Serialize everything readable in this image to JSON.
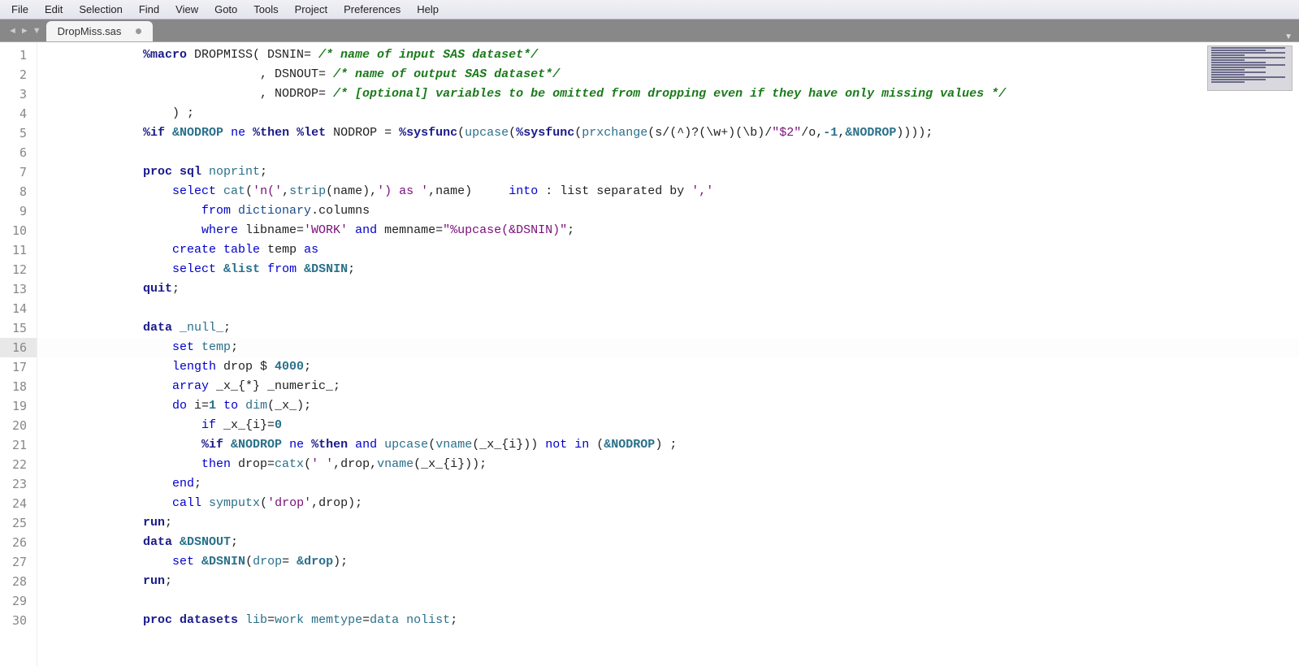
{
  "menu": [
    "File",
    "Edit",
    "Selection",
    "Find",
    "View",
    "Goto",
    "Tools",
    "Project",
    "Preferences",
    "Help"
  ],
  "tab": {
    "name": "DropMiss.sas"
  },
  "current_line": 16,
  "lines": [
    {
      "n": 1,
      "tokens": [
        [
          "kw",
          "%macro"
        ],
        [
          "id",
          " DROPMISS( DSNIN= "
        ],
        [
          "cm",
          "/* name of input SAS dataset*/"
        ]
      ]
    },
    {
      "n": 2,
      "tokens": [
        [
          "id",
          "                , DSNOUT= "
        ],
        [
          "cm",
          "/* name of output SAS dataset*/"
        ]
      ]
    },
    {
      "n": 3,
      "tokens": [
        [
          "id",
          "                , NODROP= "
        ],
        [
          "cm",
          "/* [optional] variables to be omitted from dropping even if they have only missing values */"
        ]
      ]
    },
    {
      "n": 4,
      "tokens": [
        [
          "id",
          "    ) ;"
        ]
      ]
    },
    {
      "n": 5,
      "tokens": [
        [
          "kw",
          "%if"
        ],
        [
          "id",
          " "
        ],
        [
          "mv",
          "&NODROP"
        ],
        [
          "id",
          " "
        ],
        [
          "kw2",
          "ne"
        ],
        [
          "id",
          " "
        ],
        [
          "kw",
          "%then %let"
        ],
        [
          "id",
          " NODROP = "
        ],
        [
          "kw",
          "%sysfunc"
        ],
        [
          "id",
          "("
        ],
        [
          "fn",
          "upcase"
        ],
        [
          "id",
          "("
        ],
        [
          "kw",
          "%sysfunc"
        ],
        [
          "id",
          "("
        ],
        [
          "fn",
          "prxchange"
        ],
        [
          "id",
          "(s/(^)?(\\w+)(\\b)/"
        ],
        [
          "st",
          "\"$2\""
        ],
        [
          "id",
          "/o,"
        ],
        [
          "num",
          "-1"
        ],
        [
          "id",
          ","
        ],
        [
          "mv",
          "&NODROP"
        ],
        [
          "id",
          "))));"
        ]
      ]
    },
    {
      "n": 6,
      "tokens": [
        [
          "id",
          ""
        ]
      ]
    },
    {
      "n": 7,
      "tokens": [
        [
          "kw",
          "proc sql"
        ],
        [
          "id",
          " "
        ],
        [
          "fn",
          "noprint"
        ],
        [
          "id",
          ";"
        ]
      ]
    },
    {
      "n": 8,
      "tokens": [
        [
          "id",
          "    "
        ],
        [
          "kw2",
          "select"
        ],
        [
          "id",
          " "
        ],
        [
          "fn",
          "cat"
        ],
        [
          "id",
          "("
        ],
        [
          "st",
          "'n('"
        ],
        [
          "id",
          ","
        ],
        [
          "fn",
          "strip"
        ],
        [
          "id",
          "(name),"
        ],
        [
          "st",
          "') as '"
        ],
        [
          "id",
          ",name)     "
        ],
        [
          "kw2",
          "into"
        ],
        [
          "id",
          " : list separated by "
        ],
        [
          "st",
          "','"
        ]
      ]
    },
    {
      "n": 9,
      "tokens": [
        [
          "id",
          "        "
        ],
        [
          "kw2",
          "from"
        ],
        [
          "id",
          " "
        ],
        [
          "fnname",
          "dictionary"
        ],
        [
          "id",
          ".columns"
        ]
      ]
    },
    {
      "n": 10,
      "tokens": [
        [
          "id",
          "        "
        ],
        [
          "kw2",
          "where"
        ],
        [
          "id",
          " libname="
        ],
        [
          "st",
          "'WORK'"
        ],
        [
          "id",
          " "
        ],
        [
          "kw2",
          "and"
        ],
        [
          "id",
          " memname="
        ],
        [
          "st",
          "\"%upcase(&DSNIN)\""
        ],
        [
          "id",
          ";"
        ]
      ]
    },
    {
      "n": 11,
      "tokens": [
        [
          "id",
          "    "
        ],
        [
          "kw2",
          "create"
        ],
        [
          "id",
          " "
        ],
        [
          "kw2",
          "table"
        ],
        [
          "id",
          " temp "
        ],
        [
          "kw2",
          "as"
        ]
      ]
    },
    {
      "n": 12,
      "tokens": [
        [
          "id",
          "    "
        ],
        [
          "kw2",
          "select"
        ],
        [
          "id",
          " "
        ],
        [
          "mv",
          "&list"
        ],
        [
          "id",
          " "
        ],
        [
          "kw2",
          "from"
        ],
        [
          "id",
          " "
        ],
        [
          "mv",
          "&DSNIN"
        ],
        [
          "id",
          ";"
        ]
      ]
    },
    {
      "n": 13,
      "tokens": [
        [
          "kw",
          "quit"
        ],
        [
          "id",
          ";"
        ]
      ]
    },
    {
      "n": 14,
      "tokens": [
        [
          "id",
          ""
        ]
      ]
    },
    {
      "n": 15,
      "tokens": [
        [
          "kw",
          "data"
        ],
        [
          "id",
          " "
        ],
        [
          "fn",
          "_null_"
        ],
        [
          "id",
          ";"
        ]
      ]
    },
    {
      "n": 16,
      "tokens": [
        [
          "id",
          "    "
        ],
        [
          "kw2",
          "set"
        ],
        [
          "id",
          " "
        ],
        [
          "fn",
          "temp"
        ],
        [
          "id",
          ";"
        ]
      ]
    },
    {
      "n": 17,
      "tokens": [
        [
          "id",
          "    "
        ],
        [
          "kw2",
          "length"
        ],
        [
          "id",
          " drop $ "
        ],
        [
          "num",
          "4000"
        ],
        [
          "id",
          ";"
        ]
      ]
    },
    {
      "n": 18,
      "tokens": [
        [
          "id",
          "    "
        ],
        [
          "kw2",
          "array"
        ],
        [
          "id",
          " _x_{*} _numeric_;"
        ]
      ]
    },
    {
      "n": 19,
      "tokens": [
        [
          "id",
          "    "
        ],
        [
          "kw2",
          "do"
        ],
        [
          "id",
          " i="
        ],
        [
          "num",
          "1"
        ],
        [
          "id",
          " "
        ],
        [
          "kw2",
          "to"
        ],
        [
          "id",
          " "
        ],
        [
          "fn",
          "dim"
        ],
        [
          "id",
          "(_x_);"
        ]
      ]
    },
    {
      "n": 20,
      "tokens": [
        [
          "id",
          "        "
        ],
        [
          "kw2",
          "if"
        ],
        [
          "id",
          " _x_{i}="
        ],
        [
          "num",
          "0"
        ]
      ]
    },
    {
      "n": 21,
      "tokens": [
        [
          "id",
          "        "
        ],
        [
          "kw",
          "%if"
        ],
        [
          "id",
          " "
        ],
        [
          "mv",
          "&NODROP"
        ],
        [
          "id",
          " "
        ],
        [
          "kw2",
          "ne"
        ],
        [
          "id",
          " "
        ],
        [
          "kw",
          "%then"
        ],
        [
          "id",
          " "
        ],
        [
          "kw2",
          "and"
        ],
        [
          "id",
          " "
        ],
        [
          "fn",
          "upcase"
        ],
        [
          "id",
          "("
        ],
        [
          "fn",
          "vname"
        ],
        [
          "id",
          "(_x_{i})) "
        ],
        [
          "kw2",
          "not"
        ],
        [
          "id",
          " "
        ],
        [
          "kw2",
          "in"
        ],
        [
          "id",
          " ("
        ],
        [
          "mv",
          "&NODROP"
        ],
        [
          "id",
          ") ;"
        ]
      ]
    },
    {
      "n": 22,
      "tokens": [
        [
          "id",
          "        "
        ],
        [
          "kw2",
          "then"
        ],
        [
          "id",
          " drop="
        ],
        [
          "fn",
          "catx"
        ],
        [
          "id",
          "("
        ],
        [
          "st",
          "' '"
        ],
        [
          "id",
          ",drop,"
        ],
        [
          "fn",
          "vname"
        ],
        [
          "id",
          "(_x_{i}));"
        ]
      ]
    },
    {
      "n": 23,
      "tokens": [
        [
          "id",
          "    "
        ],
        [
          "kw2",
          "end"
        ],
        [
          "id",
          ";"
        ]
      ]
    },
    {
      "n": 24,
      "tokens": [
        [
          "id",
          "    "
        ],
        [
          "kw2",
          "call"
        ],
        [
          "id",
          " "
        ],
        [
          "fn",
          "symputx"
        ],
        [
          "id",
          "("
        ],
        [
          "st",
          "'drop'"
        ],
        [
          "id",
          ",drop);"
        ]
      ]
    },
    {
      "n": 25,
      "tokens": [
        [
          "kw",
          "run"
        ],
        [
          "id",
          ";"
        ]
      ]
    },
    {
      "n": 26,
      "tokens": [
        [
          "kw",
          "data"
        ],
        [
          "id",
          " "
        ],
        [
          "mv",
          "&DSNOUT"
        ],
        [
          "id",
          ";"
        ]
      ]
    },
    {
      "n": 27,
      "tokens": [
        [
          "id",
          "    "
        ],
        [
          "kw2",
          "set"
        ],
        [
          "id",
          " "
        ],
        [
          "mv",
          "&DSNIN"
        ],
        [
          "id",
          "("
        ],
        [
          "fn",
          "drop"
        ],
        [
          "id",
          "= "
        ],
        [
          "mv",
          "&drop"
        ],
        [
          "id",
          ");"
        ]
      ]
    },
    {
      "n": 28,
      "tokens": [
        [
          "kw",
          "run"
        ],
        [
          "id",
          ";"
        ]
      ]
    },
    {
      "n": 29,
      "tokens": [
        [
          "id",
          ""
        ]
      ]
    },
    {
      "n": 30,
      "tokens": [
        [
          "kw",
          "proc datasets"
        ],
        [
          "id",
          " "
        ],
        [
          "fn",
          "lib"
        ],
        [
          "id",
          "="
        ],
        [
          "fn",
          "work"
        ],
        [
          "id",
          " "
        ],
        [
          "fn",
          "memtype"
        ],
        [
          "id",
          "="
        ],
        [
          "fn",
          "data"
        ],
        [
          "id",
          " "
        ],
        [
          "fn",
          "nolist"
        ],
        [
          "id",
          ";"
        ]
      ]
    }
  ]
}
